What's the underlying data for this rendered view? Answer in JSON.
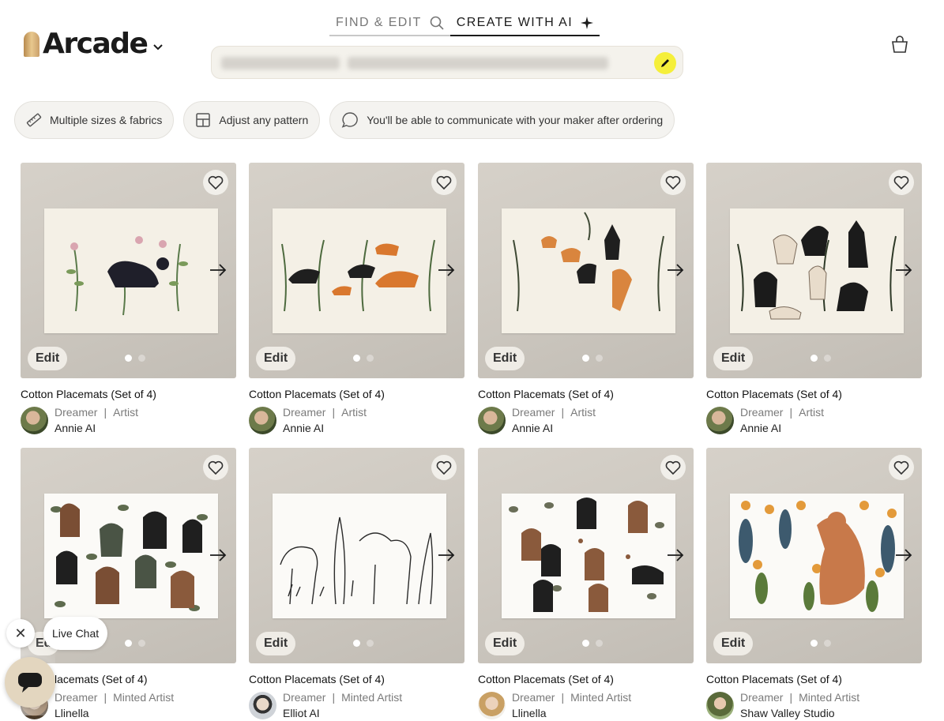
{
  "header": {
    "logo_text": "Arcade",
    "modes": [
      {
        "label": "FIND & EDIT",
        "icon": "search-icon"
      },
      {
        "label": "CREATE WITH AI",
        "icon": "sparkle-icon"
      }
    ],
    "active_mode": "CREATE WITH AI",
    "prompt_button_color": "#f5ef3a"
  },
  "chips": [
    {
      "label": "Multiple sizes & fabrics",
      "icon": "ruler-icon"
    },
    {
      "label": "Adjust any pattern",
      "icon": "layout-icon"
    },
    {
      "label": "You'll be able to communicate with your maker after ordering",
      "icon": "chat-bubble-icon"
    }
  ],
  "products": [
    {
      "title": "Cotton Placemats (Set of 4)",
      "role1": "Dreamer",
      "role2": "Artist",
      "author": "Annie AI",
      "edit": "Edit"
    },
    {
      "title": "Cotton Placemats (Set of 4)",
      "role1": "Dreamer",
      "role2": "Artist",
      "author": "Annie AI",
      "edit": "Edit"
    },
    {
      "title": "Cotton Placemats (Set of 4)",
      "role1": "Dreamer",
      "role2": "Artist",
      "author": "Annie AI",
      "edit": "Edit"
    },
    {
      "title": "Cotton Placemats (Set of 4)",
      "role1": "Dreamer",
      "role2": "Artist",
      "author": "Annie AI",
      "edit": "Edit"
    },
    {
      "title": "n Placemats (Set of 4)",
      "role1": "Dreamer",
      "role2": "Minted Artist",
      "author": "Llinella",
      "edit": "Ed"
    },
    {
      "title": "Cotton Placemats (Set of 4)",
      "role1": "Dreamer",
      "role2": "Minted Artist",
      "author": "Elliot AI",
      "edit": "Edit"
    },
    {
      "title": "Cotton Placemats (Set of 4)",
      "role1": "Dreamer",
      "role2": "Minted Artist",
      "author": "Llinella",
      "edit": "Edit"
    },
    {
      "title": "Cotton Placemats (Set of 4)",
      "role1": "Dreamer",
      "role2": "Minted Artist",
      "author": "Shaw Valley Studio",
      "edit": "Edit"
    }
  ],
  "separator": "|",
  "live_chat": {
    "label": "Live Chat",
    "close": "✕"
  }
}
